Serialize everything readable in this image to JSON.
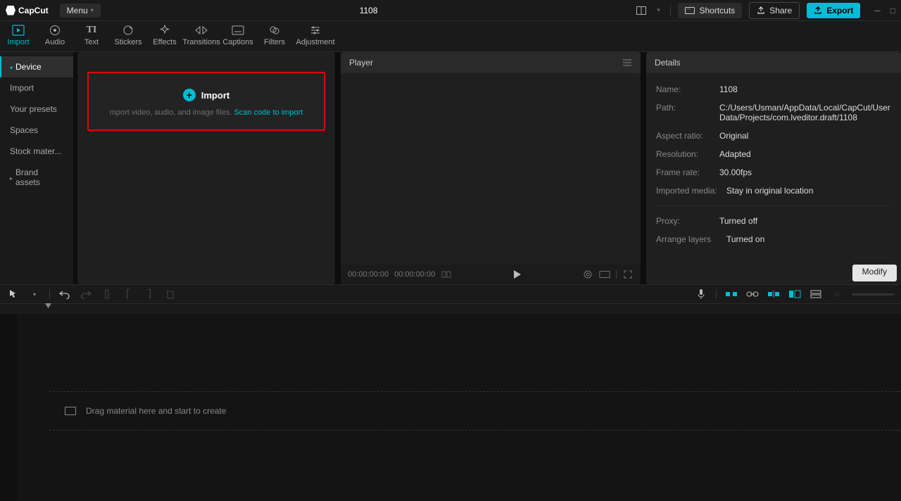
{
  "titlebar": {
    "logo": "CapCut",
    "menu": "Menu",
    "project_title": "1108",
    "shortcuts": "Shortcuts",
    "share": "Share",
    "export": "Export"
  },
  "tabs": [
    {
      "label": "Import",
      "icon": "import"
    },
    {
      "label": "Audio",
      "icon": "audio"
    },
    {
      "label": "Text",
      "icon": "text"
    },
    {
      "label": "Stickers",
      "icon": "stickers"
    },
    {
      "label": "Effects",
      "icon": "effects"
    },
    {
      "label": "Transitions",
      "icon": "transitions"
    },
    {
      "label": "Captions",
      "icon": "captions"
    },
    {
      "label": "Filters",
      "icon": "filters"
    },
    {
      "label": "Adjustment",
      "icon": "adjustment"
    }
  ],
  "sidebar": {
    "items": [
      {
        "label": "Device",
        "expandable": true,
        "active": true
      },
      {
        "label": "Import"
      },
      {
        "label": "Your presets"
      },
      {
        "label": "Spaces"
      },
      {
        "label": "Stock mater..."
      },
      {
        "label": "Brand assets",
        "expandable": true
      }
    ]
  },
  "import_box": {
    "title": "Import",
    "subtitle_prefix": "mport video, audio, and image files. ",
    "link": "Scan code to import"
  },
  "player": {
    "title": "Player",
    "time_current": "00:00:00:00",
    "time_total": "00:00:00:00"
  },
  "details": {
    "title": "Details",
    "rows": [
      {
        "label": "Name:",
        "value": "1108"
      },
      {
        "label": "Path:",
        "value": "C:/Users/Usman/AppData/Local/CapCut/User Data/Projects/com.lveditor.draft/1108"
      },
      {
        "label": "Aspect ratio:",
        "value": "Original"
      },
      {
        "label": "Resolution:",
        "value": "Adapted"
      },
      {
        "label": "Frame rate:",
        "value": "30.00fps"
      },
      {
        "label": "Imported media:",
        "value": "Stay in original location"
      }
    ],
    "rows2": [
      {
        "label": "Proxy:",
        "value": "Turned off"
      },
      {
        "label": "Arrange layers",
        "value": "Turned on"
      }
    ],
    "modify": "Modify"
  },
  "timeline": {
    "drag_hint": "Drag material here and start to create"
  }
}
